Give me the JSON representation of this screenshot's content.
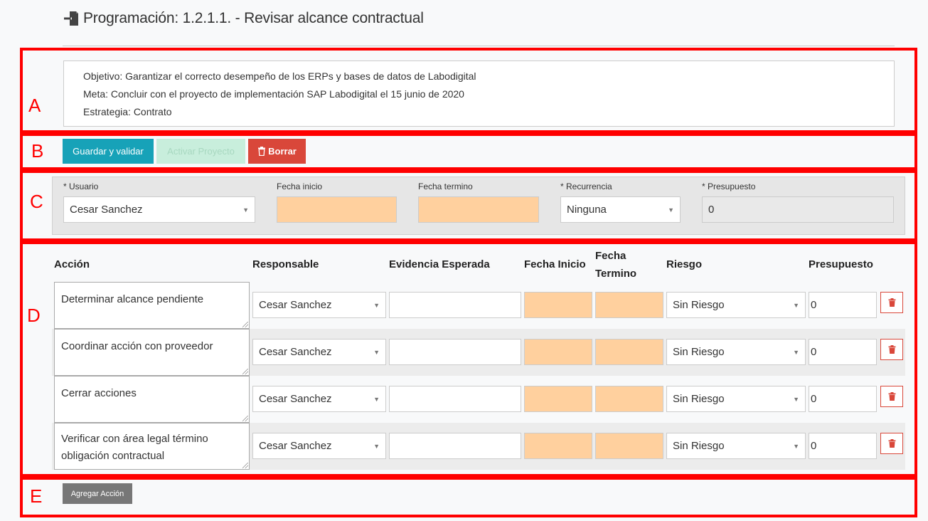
{
  "header": {
    "title": "Programación: 1.2.1.1. - Revisar alcance contractual",
    "icon": "sign-in-icon"
  },
  "annotations": [
    "A",
    "B",
    "C",
    "D",
    "E"
  ],
  "info": {
    "objetivo": "Objetivo: Garantizar el correcto desempeño de los ERPs y bases de datos de Labodigital",
    "meta": "Meta: Concluir con el proyecto de implementación SAP Labodigital el 15 junio de 2020",
    "estrategia": "Estrategia: Contrato"
  },
  "toolbar": {
    "save_label": "Guardar y validar",
    "activate_label": "Activar Proyecto",
    "delete_label": "Borrar"
  },
  "form": {
    "usuario_label": "* Usuario",
    "usuario_value": "Cesar Sanchez",
    "fecha_inicio_label": "Fecha inicio",
    "fecha_inicio_value": "",
    "fecha_termino_label": "Fecha termino",
    "fecha_termino_value": "",
    "recurrencia_label": "* Recurrencia",
    "recurrencia_value": "Ninguna",
    "presupuesto_label": "* Presupuesto",
    "presupuesto_value": "0"
  },
  "table": {
    "headers": {
      "accion": "Acción",
      "responsable": "Responsable",
      "evidencia": "Evidencia Esperada",
      "fecha_inicio": "Fecha Inicio",
      "fecha_termino_1": "Fecha",
      "fecha_termino_2": "Termino",
      "riesgo": "Riesgo",
      "presupuesto": "Presupuesto"
    },
    "rows": [
      {
        "accion": "Determinar alcance pendiente",
        "responsable": "Cesar Sanchez",
        "evidencia": "",
        "fecha_inicio": "",
        "fecha_termino": "",
        "riesgo": "Sin Riesgo",
        "presupuesto": "0"
      },
      {
        "accion": "Coordinar acción con proveedor",
        "responsable": "Cesar Sanchez",
        "evidencia": "",
        "fecha_inicio": "",
        "fecha_termino": "",
        "riesgo": "Sin Riesgo",
        "presupuesto": "0"
      },
      {
        "accion": "Cerrar acciones",
        "responsable": "Cesar Sanchez",
        "evidencia": "",
        "fecha_inicio": "",
        "fecha_termino": "",
        "riesgo": "Sin Riesgo",
        "presupuesto": "0"
      },
      {
        "accion": "Verificar con área legal término obligación contractual",
        "responsable": "Cesar Sanchez",
        "evidencia": "",
        "fecha_inicio": "",
        "fecha_termino": "",
        "riesgo": "Sin Riesgo",
        "presupuesto": "0"
      }
    ]
  },
  "footer": {
    "add_label": "Agregar Acción"
  },
  "colors": {
    "annotation": "#ff0000",
    "primary": "#17a2b8",
    "success_disabled": "#c8eedc",
    "danger": "#d9473a",
    "date_field": "#ffd09e",
    "secondary": "#777777"
  }
}
